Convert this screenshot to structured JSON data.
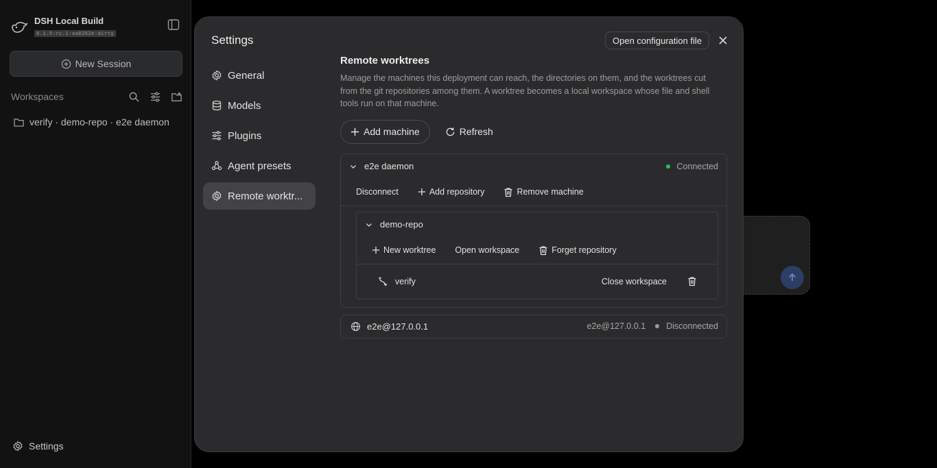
{
  "sidebar": {
    "brand_title": "DSH Local Build",
    "brand_version": "0.1.5-rc.1-aa8262e-dirty",
    "new_session_label": "New Session",
    "workspaces_title": "Workspaces",
    "workspace_item": "verify · demo-repo · e2e daemon",
    "settings_label": "Settings"
  },
  "modal": {
    "title": "Settings",
    "open_config_label": "Open configuration file",
    "nav": [
      {
        "label": "General",
        "icon": "gear-icon"
      },
      {
        "label": "Models",
        "icon": "database-icon"
      },
      {
        "label": "Plugins",
        "icon": "sliders-icon"
      },
      {
        "label": "Agent presets",
        "icon": "presets-icon"
      },
      {
        "label": "Remote worktr...",
        "icon": "gear-icon",
        "active": true
      }
    ],
    "section": {
      "title": "Remote worktrees",
      "description": "Manage the machines this deployment can reach, the directories on them, and the worktrees cut from the git repositories among them. A worktree becomes a local workspace whose file and shell tools run on that machine.",
      "add_machine_label": "Add machine",
      "refresh_label": "Refresh"
    },
    "machines": [
      {
        "name": "e2e daemon",
        "status": "Connected",
        "status_color": "#22c55e",
        "actions": {
          "disconnect": "Disconnect",
          "add_repository": "Add repository",
          "remove_machine": "Remove machine"
        },
        "repo": {
          "name": "demo-repo",
          "actions": {
            "new_worktree": "New worktree",
            "open_workspace": "Open workspace",
            "forget_repository": "Forget repository"
          },
          "worktree": {
            "name": "verify",
            "close_label": "Close workspace"
          }
        }
      },
      {
        "name": "e2e@127.0.0.1",
        "host": "e2e@127.0.0.1",
        "status": "Disconnected",
        "status_color": "#9a9a9a"
      }
    ]
  },
  "colors": {
    "accent_send": "#2c3e63"
  }
}
